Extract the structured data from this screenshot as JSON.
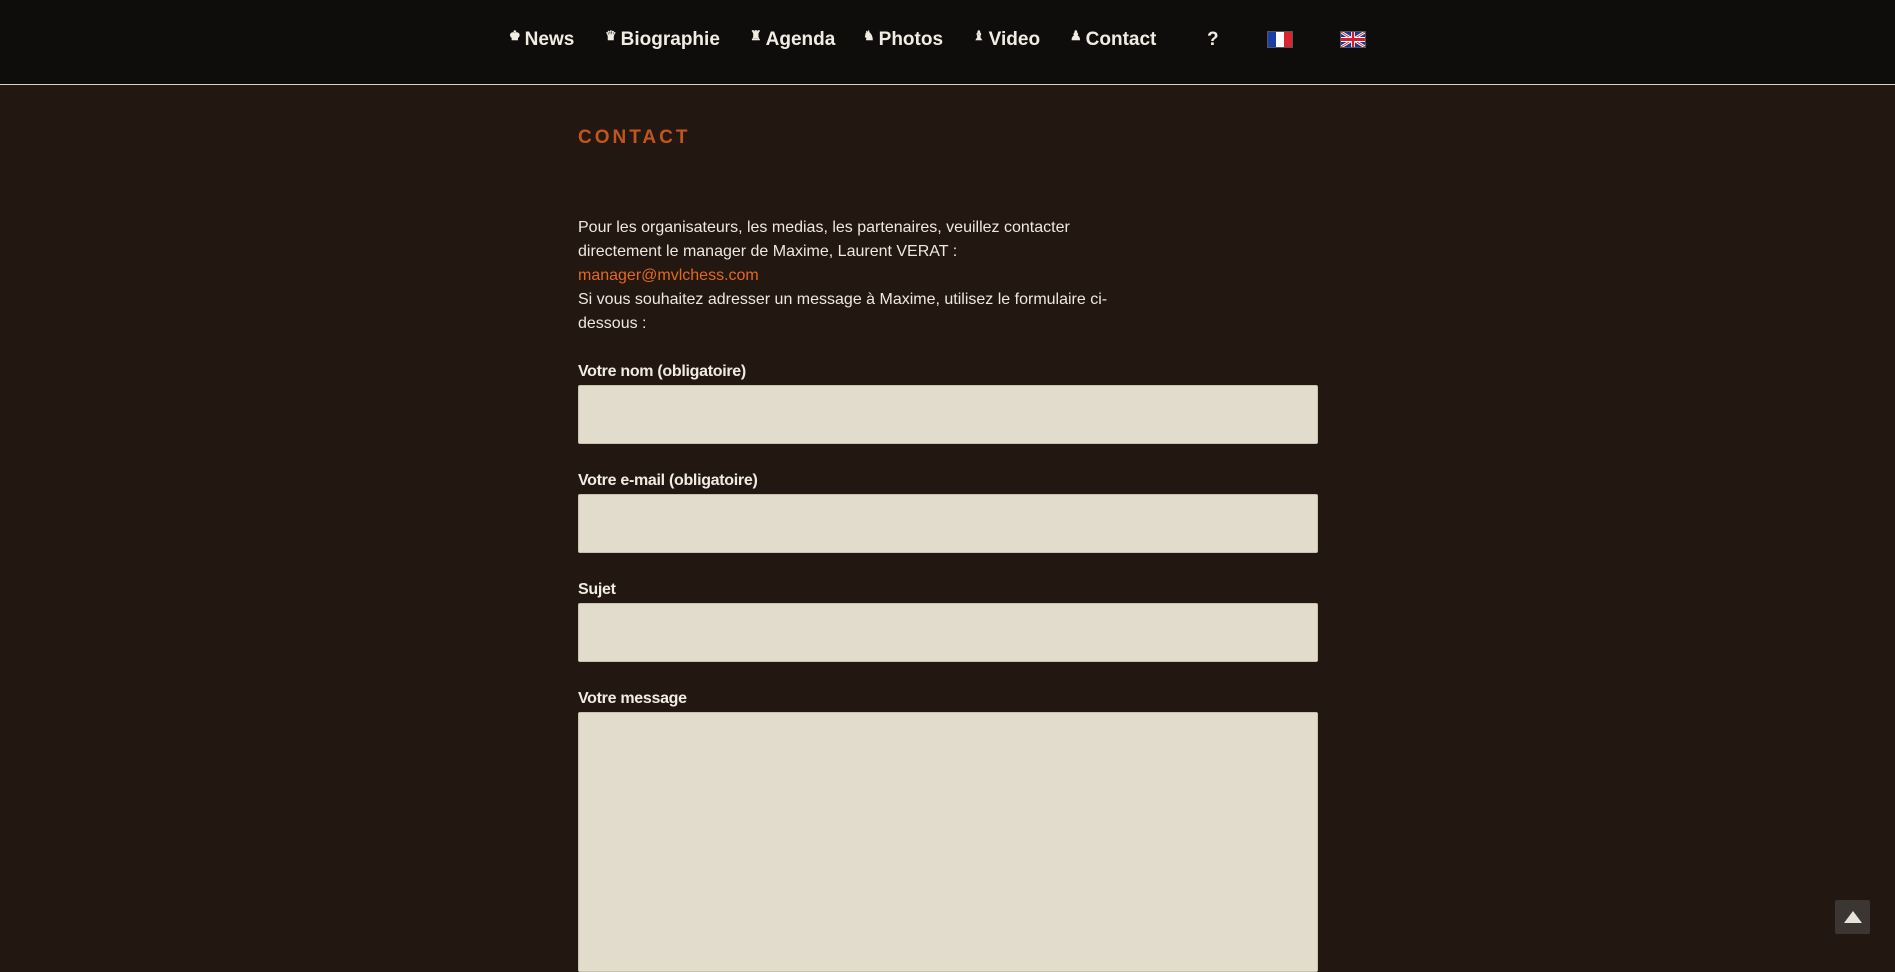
{
  "nav": {
    "items": [
      {
        "label": "News",
        "icon": "♚"
      },
      {
        "label": "Biographie",
        "icon": "♛"
      },
      {
        "label": "Agenda",
        "icon": "♜"
      },
      {
        "label": "Photos",
        "icon": "♞"
      },
      {
        "label": "Video",
        "icon": "♝"
      },
      {
        "label": "Contact",
        "icon": "♟"
      }
    ],
    "help_label": "?",
    "languages": [
      "fr-flag-icon",
      "uk-flag-icon"
    ]
  },
  "page": {
    "title": "CONTACT",
    "intro_text": "Pour les organisateurs, les medias, les partenaires, veuillez contacter directement le manager de Maxime, Laurent VERAT : ",
    "manager_email": "manager@mvlchess.com",
    "form_intro": "Si vous souhaitez adresser un message à Maxime, utilisez le formulaire ci-dessous :"
  },
  "form": {
    "name_label": "Votre nom (obligatoire)",
    "name_value": "",
    "email_label": "Votre e-mail (obligatoire)",
    "email_value": "",
    "subject_label": "Sujet",
    "subject_value": "",
    "message_label": "Votre message",
    "message_value": ""
  },
  "colors": {
    "background": "#221811",
    "topbar": "#0f0d0b",
    "accent": "#c0561c",
    "link": "#e4681b",
    "field": "#e2dccc"
  }
}
